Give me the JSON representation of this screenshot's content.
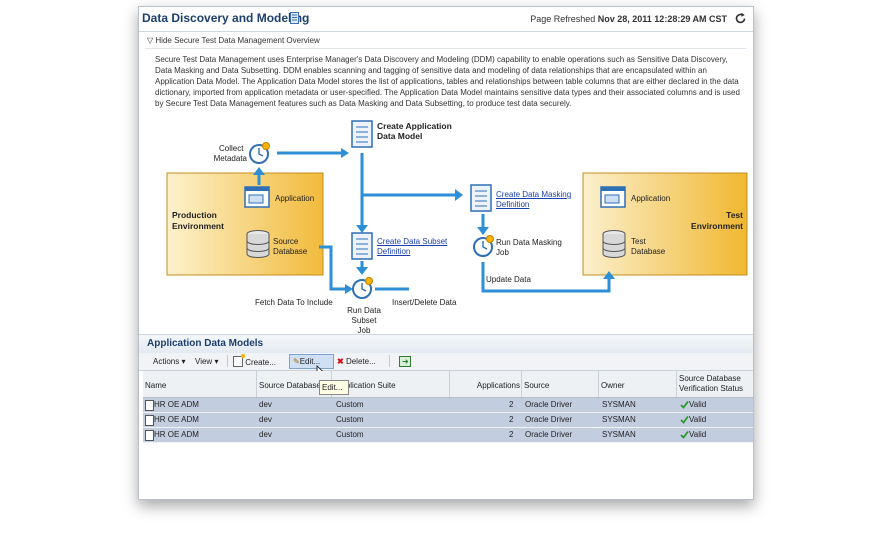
{
  "header": {
    "title": "Data Discovery and Modeling",
    "refresh_label": "Page Refreshed",
    "refresh_time": "Nov 28, 2011 12:28:29 AM CST"
  },
  "overview": {
    "toggle_label": "Hide Secure Test Data Management Overview",
    "description": "Secure Test Data Management uses Enterprise Manager's Data Discovery and Modeling (DDM) capability to enable operations such as Sensitive Data Discovery, Data Masking and Data Subsetting. DDM enables scanning and tagging of sensitive data and modeling of data relationships that are encapsulated within an Application Data Model. The Application Data Model stores the list of applications, tables and relationships between table columns that are either declared in the data dictionary, imported from application metadata or user-specified. The Application Data Model maintains sensitive data types and their associated columns and is used by Secure Test Data Management features such as Data Masking and Data Subsetting, to produce test data securely."
  },
  "diagram": {
    "collect_metadata": [
      "Collect",
      "Metadata"
    ],
    "create_adm": [
      "Create Application",
      "Data Model"
    ],
    "production_env": [
      "Production",
      "Environment"
    ],
    "prod_application": "Application",
    "prod_source_db": [
      "Source",
      "Database"
    ],
    "create_subset_def": [
      "Create Data Subset",
      "Definition"
    ],
    "create_masking_def": [
      "Create Data Masking",
      "Definition"
    ],
    "run_masking_job": [
      "Run Data Masking",
      "Job"
    ],
    "update_data": "Update Data",
    "fetch_data": "Fetch Data To Include",
    "run_subset_job": [
      "Run Data",
      "Subset Job"
    ],
    "insert_delete": "Insert/Delete Data",
    "test_env": [
      "Test",
      "Environment"
    ],
    "test_application": "Application",
    "test_db": [
      "Test",
      "Database"
    ]
  },
  "section": {
    "title": "Application Data Models"
  },
  "toolbar": {
    "actions": "Actions",
    "view": "View",
    "create": "Create...",
    "edit": "Edit...",
    "delete": "Delete...",
    "tooltip": "Edit..."
  },
  "table": {
    "columns": [
      "Name",
      "Source Database",
      "Application Suite",
      "Applications",
      "Source",
      "Owner",
      "Source Database Verification Status"
    ],
    "rows": [
      {
        "name": "HR OE ADM",
        "source_db": "dev",
        "suite": "Custom",
        "apps": "2",
        "source": "Oracle Driver",
        "owner": "SYSMAN",
        "status": "Valid"
      },
      {
        "name": "HR OE ADM",
        "source_db": "dev",
        "suite": "Custom",
        "apps": "2",
        "source": "Oracle Driver",
        "owner": "SYSMAN",
        "status": "Valid"
      },
      {
        "name": "HR OE ADM",
        "source_db": "dev",
        "suite": "Custom",
        "apps": "2",
        "source": "Oracle Driver",
        "owner": "SYSMAN",
        "status": "Valid"
      }
    ]
  },
  "colors": {
    "title": "#1c3f6e",
    "arrow": "#2e8fd6",
    "link": "#1a3fb0",
    "row": "#c3cde0",
    "env": "#f3c04a"
  }
}
